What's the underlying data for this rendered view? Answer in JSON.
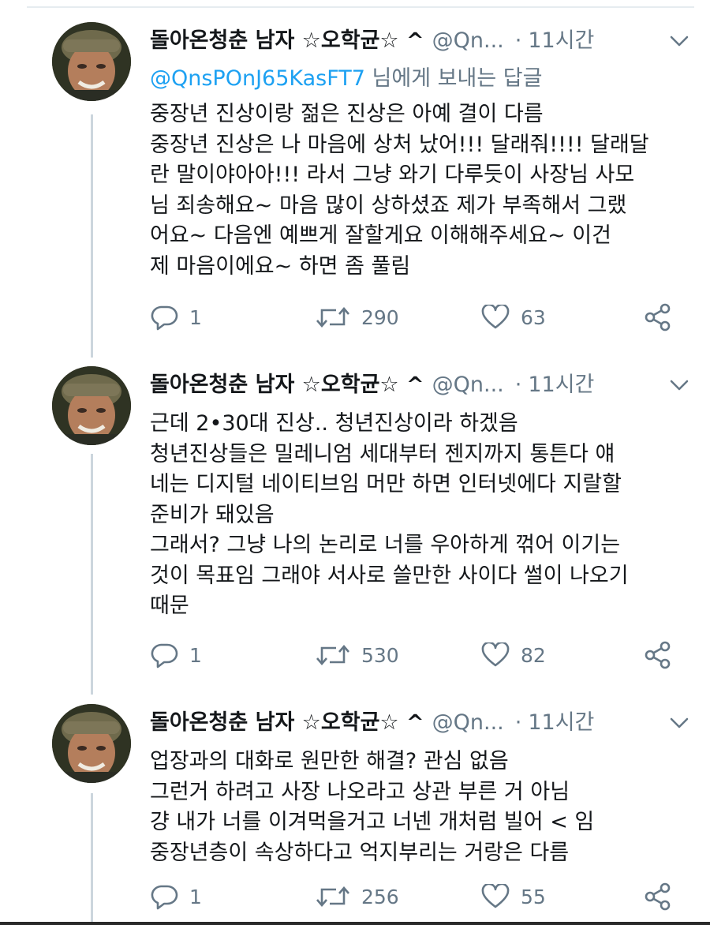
{
  "tweets": [
    {
      "display_name": "돌아온청춘 남자 ☆오학균☆ ^",
      "handle": "@Qn...",
      "separator": "·",
      "time": "11시간",
      "reply_to_handle": "@QnsPOnJ65KasFT7",
      "reply_to_suffix": " 님에게 보내는 답글",
      "lines": [
        "중장년 진상이랑 젊은 진상은 아예 결이 다름",
        "중장년 진상은 나 마음에 상처 났어!!! 달래줘!!!! 달래달",
        "란 말이야아아!!! 라서 그냥 와기 다루듯이 사장님 사모",
        "님 죄송해요~ 마음 많이 상하셨죠 제가 부족해서 그랬",
        "어요~ 다음엔 예쁘게 잘할게요 이해해주세요~ 이건",
        "제 마음이에요~ 하면 좀 풀림"
      ],
      "replies": "1",
      "retweets": "290",
      "likes": "63"
    },
    {
      "display_name": "돌아온청춘 남자 ☆오학균☆ ^",
      "handle": "@Qn...",
      "separator": "·",
      "time": "11시간",
      "lines": [
        "근데 2•30대 진상.. 청년진상이라 하겠음",
        "청년진상들은 밀레니엄 세대부터 젠지까지 통튼다 얘",
        "네는 디지털 네이티브임 머만 하면 인터넷에다 지랄할",
        "준비가 돼있음",
        "그래서? 그냥 나의 논리로 너를 우아하게 꺾어 이기는",
        "것이 목표임 그래야 서사로 쓸만한 사이다 썰이 나오기",
        "때문"
      ],
      "replies": "1",
      "retweets": "530",
      "likes": "82"
    },
    {
      "display_name": "돌아온청춘 남자 ☆오학균☆ ^",
      "handle": "@Qn...",
      "separator": "·",
      "time": "11시간",
      "lines": [
        "업장과의 대화로 원만한 해결? 관심 없음",
        "그런거 하려고 사장 나오라고 상관 부른 거 아님",
        "걍 내가 너를 이겨먹을거고 너넨 개처럼 빌어 < 임",
        "중장년층이 속상하다고 억지부리는 거랑은 다름"
      ],
      "replies": "1",
      "retweets": "256",
      "likes": "55"
    }
  ],
  "colors": {
    "text": "#14171a",
    "secondary": "#657786",
    "link": "#1da1f2",
    "thread_line": "#ccd6dd"
  },
  "icons": [
    "reply-icon",
    "retweet-icon",
    "like-icon",
    "share-icon",
    "chevron-down-icon"
  ]
}
